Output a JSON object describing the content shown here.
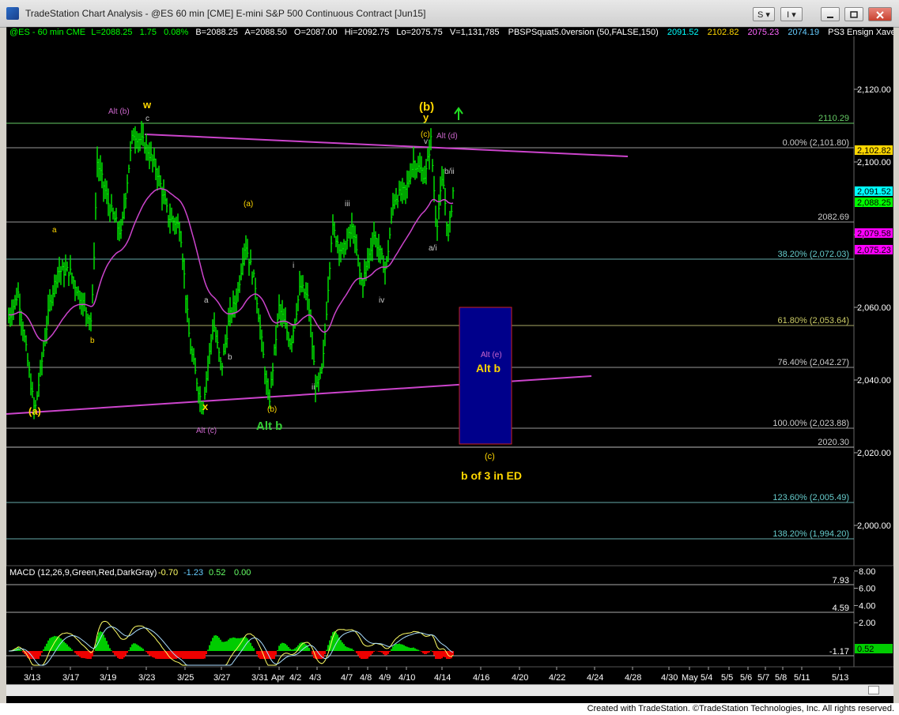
{
  "window": {
    "title": "TradeStation Chart Analysis - @ES 60 min [CME] E-mini S&P 500 Continuous Contract [Jun15]",
    "buttons": {
      "s_label": "S",
      "i_label": "I"
    }
  },
  "header": {
    "symbol": "@ES - 60 min  CME",
    "last": "L=2088.25",
    "change": "1.75",
    "pct": "0.08%",
    "bid": "B=2088.25",
    "ask": "A=2088.50",
    "open": "O=2087.00",
    "high": "Hi=2092.75",
    "low": "Lo=2075.75",
    "volume": "V=1,131,785",
    "study": "PBSPSquat5.0version (50,FALSE,150)",
    "v1": "2091.52",
    "v2": "2102.82",
    "v3": "2075.23",
    "v4": "2074.19",
    "extra": "PS3 Ensign Xave. ..."
  },
  "price_axis": [
    "2,120.00",
    "2,100.00",
    "2,080.00",
    "2,060.00",
    "2,040.00",
    "2,020.00",
    "2,000.00"
  ],
  "price_tags": [
    {
      "text": "2,102.82",
      "color": "#ffd700",
      "text_color": "#000000"
    },
    {
      "text": "2,091.52",
      "color": "#00ffff",
      "text_color": "#000000"
    },
    {
      "text": "2,088.25",
      "color": "#00ff00",
      "text_color": "#000000"
    },
    {
      "text": "2,079.58",
      "color": "#ff00ff",
      "text_color": "#000000"
    },
    {
      "text": "2,075.23",
      "color": "#ff00ff",
      "text_color": "#000000"
    }
  ],
  "levels": [
    {
      "text": "2110.29",
      "color": "#66cc66"
    },
    {
      "text": "0.00% (2,101.80)",
      "color": "#cccccc"
    },
    {
      "text": "2082.69",
      "color": "#cccccc"
    },
    {
      "text": "38.20% (2,072.03)",
      "color": "#66cccc"
    },
    {
      "text": "61.80% (2,053.64)",
      "color": "#cccc66"
    },
    {
      "text": "76.40% (2,042.27)",
      "color": "#cccccc"
    },
    {
      "text": "100.00% (2,023.88)",
      "color": "#cccccc"
    },
    {
      "text": "2020.30",
      "color": "#cccccc"
    },
    {
      "text": "123.60% (2,005.49)",
      "color": "#66cccc"
    },
    {
      "text": "138.20% (1,994.20)",
      "color": "#66cccc"
    }
  ],
  "annotations": [
    {
      "text": "Alt (b)",
      "color": "#cc66cc"
    },
    {
      "text": "w",
      "color": "#ffd700"
    },
    {
      "text": "c",
      "color": "#cccccc"
    },
    {
      "text": "a",
      "color": "#ffd700"
    },
    {
      "text": "b",
      "color": "#ffd700"
    },
    {
      "text": "(a)",
      "color": "#ffd700"
    },
    {
      "text": "a",
      "color": "#cccccc"
    },
    {
      "text": "b",
      "color": "#cccccc"
    },
    {
      "text": "x",
      "color": "#ffd700"
    },
    {
      "text": "Alt (c)",
      "color": "#cc66cc"
    },
    {
      "text": "(a)",
      "color": "#ffd700"
    },
    {
      "text": "(b)",
      "color": "#ffd700"
    },
    {
      "text": "Alt b",
      "color": "#33cc33"
    },
    {
      "text": "i",
      "color": "#cccccc"
    },
    {
      "text": "ii",
      "color": "#cccccc"
    },
    {
      "text": "iii",
      "color": "#cccccc"
    },
    {
      "text": "iv",
      "color": "#cccccc"
    },
    {
      "text": "(b)",
      "color": "#ffd700"
    },
    {
      "text": "y",
      "color": "#ffd700"
    },
    {
      "text": "(c)",
      "color": "#ffd700"
    },
    {
      "text": "v",
      "color": "#cccccc"
    },
    {
      "text": "Alt (d)",
      "color": "#cc66cc"
    },
    {
      "text": "b/ii",
      "color": "#cccccc"
    },
    {
      "text": "a/i",
      "color": "#cccccc"
    },
    {
      "text": "Alt (e)",
      "color": "#cc66cc"
    },
    {
      "text": "Alt b",
      "color": "#ffd700"
    },
    {
      "text": "(c)",
      "color": "#ffd700"
    },
    {
      "text": "b of 3 in ED",
      "color": "#ffd700"
    }
  ],
  "macd": {
    "label": "MACD (12,26,9,Green,Red,DarkGray)",
    "values": [
      {
        "text": "-0.70",
        "color": "#ffff66"
      },
      {
        "text": "-1.23",
        "color": "#66ccff"
      },
      {
        "text": "0.52",
        "color": "#66ff66"
      },
      {
        "text": "0.00",
        "color": "#66ff66"
      }
    ],
    "axis": [
      "8.00",
      "6.00",
      "4.00",
      "2.00"
    ],
    "levels": [
      "7.93",
      "4.59",
      "-1.17"
    ],
    "tag": "0.52"
  },
  "dates": [
    "3/13",
    "3/17",
    "3/19",
    "3/23",
    "3/25",
    "3/27",
    "3/31",
    "Apr",
    "4/2",
    "4/3",
    "4/7",
    "4/8",
    "4/9",
    "4/10",
    "4/14",
    "4/16",
    "4/20",
    "4/22",
    "4/24",
    "4/28",
    "4/30",
    "May",
    "5/4",
    "5/5",
    "5/6",
    "5/7",
    "5/8",
    "5/11",
    "5/13"
  ],
  "footer": "Created with TradeStation. ©TradeStation Technologies, Inc. All rights reserved."
}
